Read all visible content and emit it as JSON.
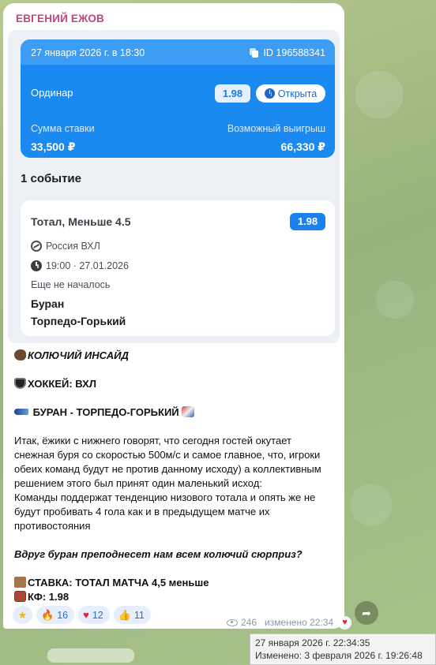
{
  "message": {
    "sender": "ЕВГЕНИЙ ЕЖОВ",
    "bet_card": {
      "date": "27 января 2026 г. в 18:30",
      "id": "ID 196588341",
      "bet_type": "Ординар",
      "odds": "1.98",
      "status": "Открыта",
      "stake_label": "Сумма ставки",
      "stake_value": "33,500 ₽",
      "win_label": "Возможный выигрыш",
      "win_value": "66,330 ₽"
    },
    "events_title": "1 событие",
    "event": {
      "market": "Тотал, Меньше 4.5",
      "odds": "1.98",
      "league": "Россия ВХЛ",
      "time": "19:00 · 27.01.2026",
      "status": "Еще не началось",
      "team_home": "Буран",
      "team_away": "Торпедо-Горький"
    },
    "text": {
      "headline": "КОЛЮЧИЙ ИНСАЙД",
      "sport": "ХОККЕЙ: ВХЛ",
      "match": "БУРАН - ТОРПЕДО-ГОРЬКИЙ",
      "p1_l1": "Итак, ёжики с нижнего говорят, что сегодня гостей окутает",
      "p1_l2": "снежная буря со скоростью 500м/с и самое главное, что, игроки",
      "p1_l3": "обеих команд будут не против данному исходу) а коллективным",
      "p1_l4": "решением этого был принят один маленький исход:",
      "p1_l5": "Команды поддержат тенденцию низового тотала и опять же не",
      "p1_l6": "будут пробивать 4 гола как и в предыдущем матче их",
      "p1_l7": "противостояния",
      "question": "Вдруг буран преподнесет нам всем колючий сюрприз?",
      "bet_line": "СТАВКА: ТОТАЛ МАТЧА 4,5 меньше",
      "coef_line": "КФ: 1.98"
    },
    "reactions": [
      {
        "icon": "star-icon",
        "glyph": "★",
        "count": ""
      },
      {
        "icon": "fire-icon",
        "glyph": "🔥",
        "count": "16"
      },
      {
        "icon": "heart-icon",
        "glyph": "♥",
        "count": "12"
      },
      {
        "icon": "thumbs-up-icon",
        "glyph": "👍",
        "count": "11"
      }
    ],
    "views": "246",
    "edited": "изменено 22:34"
  },
  "tooltip": {
    "sent": "27 января 2026 г. 22:34:35",
    "edited": "Изменено: 3 февраля 2026 г. 19:26:48"
  },
  "colors": {
    "sender": "#c0457e",
    "accent_blue": "#1a8af1",
    "chat_bg": "#a9c08a"
  }
}
